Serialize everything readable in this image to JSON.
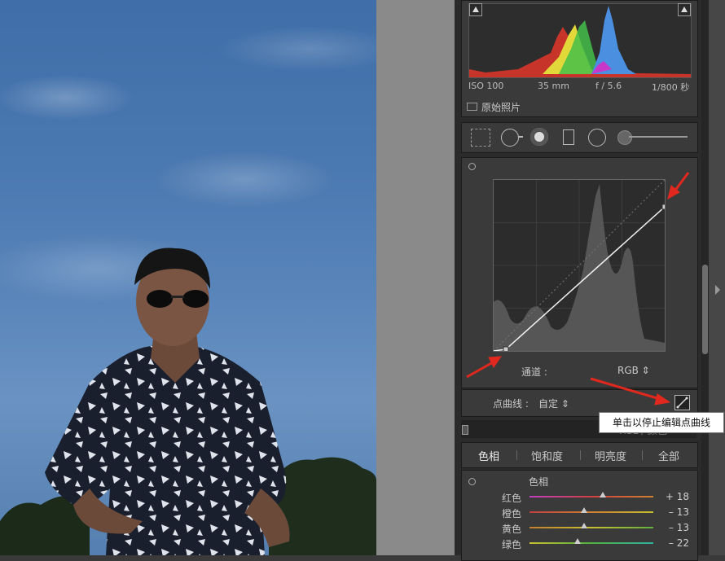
{
  "histogram": {
    "iso": "ISO 100",
    "focal": "35 mm",
    "aperture": "f / 5.6",
    "shutter": "1/800 秒",
    "original_photo_label": "原始照片"
  },
  "tools": {
    "icons": [
      "crop-overlay-icon",
      "spot-removal-icon",
      "red-eye-icon",
      "graduated-filter-icon",
      "radial-filter-icon",
      "adjustment-brush-icon"
    ]
  },
  "tone_curve": {
    "channel_label": "通道 :",
    "channel_value": "RGB ⇕",
    "point_curve_label": "点曲线 :",
    "point_curve_value": "自定 ⇕",
    "tooltip": "单击以停止编辑点曲线"
  },
  "hsl": {
    "header_text": "HSL / 颜色",
    "tabs": [
      "色相",
      "饱和度",
      "明亮度",
      "全部"
    ],
    "active_tab": "色相",
    "section_label": "色相",
    "rows": [
      {
        "label": "红色",
        "value": "+ 18",
        "level": 0.59
      },
      {
        "label": "橙色",
        "value": "– 13",
        "level": 0.44
      },
      {
        "label": "黄色",
        "value": "– 13",
        "level": 0.44
      },
      {
        "label": "绿色",
        "value": "– 22",
        "level": 0.39
      }
    ]
  },
  "colors": {
    "annotation_red": "#e0281e",
    "panel_bg": "#2b2b2b"
  }
}
